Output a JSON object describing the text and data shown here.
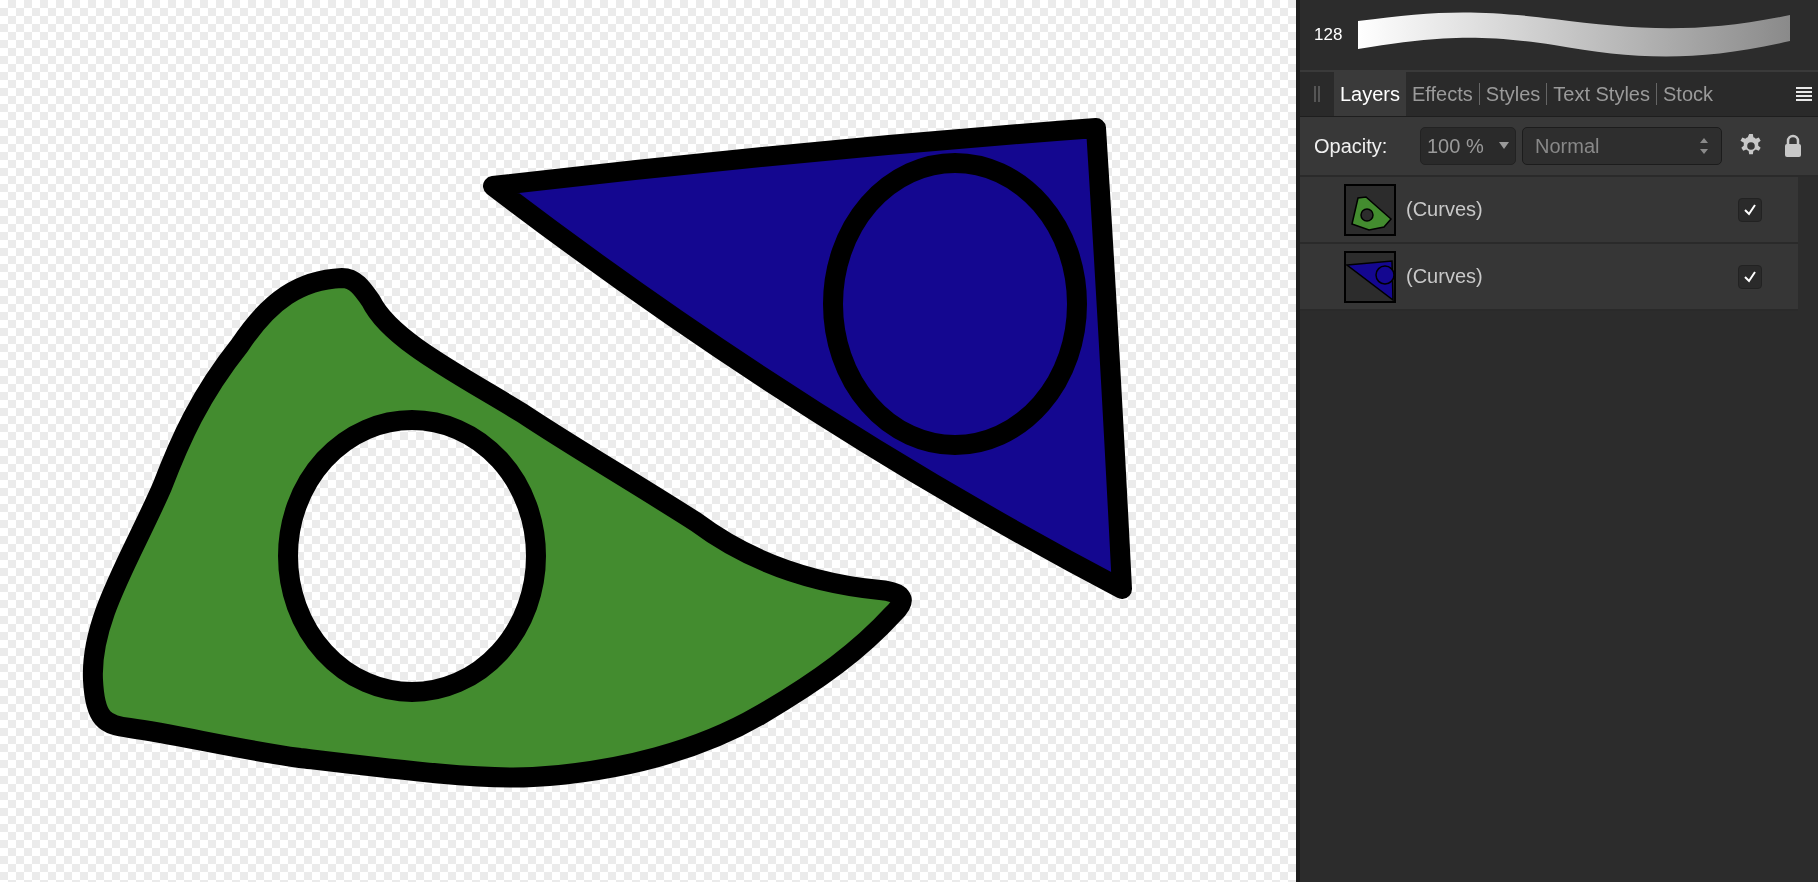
{
  "brush": {
    "size": "128"
  },
  "tabs": [
    {
      "label": "Layers",
      "selected": true
    },
    {
      "label": "Effects",
      "selected": false
    },
    {
      "label": "Styles",
      "selected": false
    },
    {
      "label": "Text Styles",
      "selected": false
    },
    {
      "label": "Stock",
      "selected": false
    }
  ],
  "opacity": {
    "label": "Opacity:",
    "value": "100 %"
  },
  "blend_mode": {
    "value": "Normal"
  },
  "layers": [
    {
      "name": "(Curves)",
      "kind": "blob",
      "color": "#438c2f",
      "visible": true
    },
    {
      "name": "(Curves)",
      "kind": "triangle",
      "color": "#140790",
      "visible": true
    }
  ]
}
